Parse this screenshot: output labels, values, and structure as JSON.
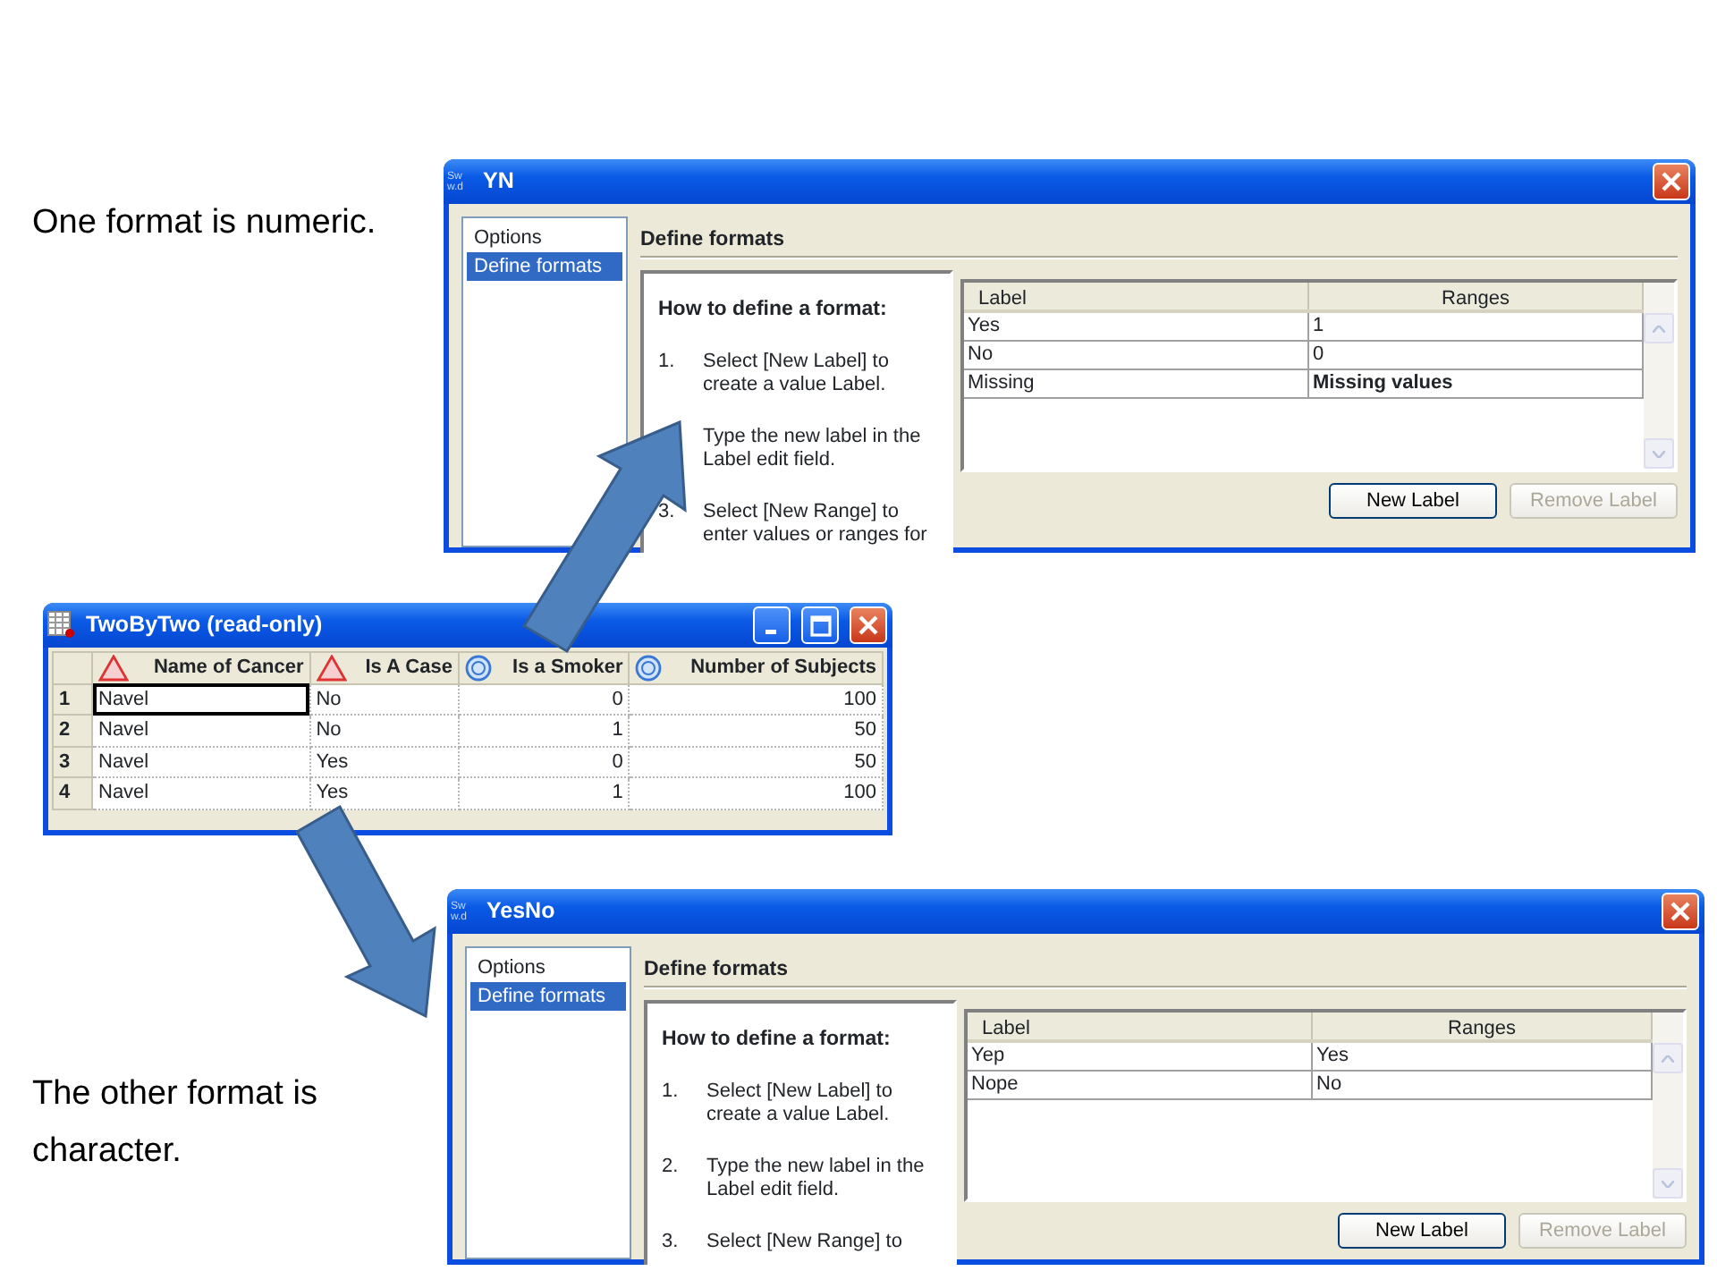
{
  "captions": [
    {
      "text": "One format is numeric."
    },
    {
      "text": "The other format is character."
    }
  ],
  "format_dialogs": [
    {
      "title": "YN",
      "app_icon": [
        "Sw",
        "w.d"
      ],
      "sidebar": {
        "items": [
          {
            "label": "Options",
            "selected": false
          },
          {
            "label": "Define formats",
            "selected": true
          }
        ]
      },
      "heading": "Define formats",
      "instructions": {
        "title": "How to define a format:",
        "steps": [
          {
            "number": "1.",
            "lines": [
              "Select [New Label] to",
              "create a value Label."
            ]
          },
          {
            "lines": [
              "Type the new label in the",
              "Label edit field."
            ]
          },
          {
            "number": "3.",
            "lines": [
              "Select [New Range] to",
              "enter values or ranges for"
            ]
          }
        ]
      },
      "grid": {
        "columns": [
          "Label",
          "Ranges"
        ],
        "rows": [
          {
            "label": "Yes",
            "ranges": "1",
            "bold": false
          },
          {
            "label": "No",
            "ranges": "0",
            "bold": false
          },
          {
            "label": "Missing",
            "ranges": "Missing values",
            "bold": true
          }
        ]
      },
      "buttons": [
        {
          "label": "New Label",
          "disabled": false
        },
        {
          "label": "Remove Label",
          "disabled": true
        }
      ]
    },
    {
      "title": "YesNo",
      "app_icon": [
        "Sw",
        "w.d"
      ],
      "sidebar": {
        "items": [
          {
            "label": "Options",
            "selected": false
          },
          {
            "label": "Define formats",
            "selected": true
          }
        ]
      },
      "heading": "Define formats",
      "instructions": {
        "title": "How to define a format:",
        "steps": [
          {
            "number": "1.",
            "lines": [
              "Select [New Label] to",
              "create a value Label."
            ]
          },
          {
            "number": "2.",
            "lines": [
              "Type the new label in the",
              "Label edit field."
            ]
          },
          {
            "number": "3.",
            "lines": [
              "Select [New Range] to"
            ]
          }
        ]
      },
      "grid": {
        "columns": [
          "Label",
          "Ranges"
        ],
        "rows": [
          {
            "label": "Yep",
            "ranges": "Yes",
            "bold": false
          },
          {
            "label": "Nope",
            "ranges": "No",
            "bold": false
          }
        ]
      },
      "buttons": [
        {
          "label": "New Label",
          "disabled": false
        },
        {
          "label": "Remove Label",
          "disabled": true
        }
      ]
    }
  ],
  "data_window": {
    "title": "TwoByTwo (read-only)",
    "columns": [
      {
        "name": "Name of Cancer",
        "kind": "character"
      },
      {
        "name": "Is A Case",
        "kind": "character"
      },
      {
        "name": "Is a Smoker",
        "kind": "numeric"
      },
      {
        "name": "Number of Subjects",
        "kind": "numeric"
      }
    ],
    "rows": [
      {
        "header": "1",
        "cells": [
          {
            "text": "Navel",
            "selected": true
          },
          {
            "text": "No",
            "selected": false
          },
          {
            "text": "0",
            "selected": false
          },
          {
            "text": "100",
            "selected": false
          }
        ]
      },
      {
        "header": "2",
        "cells": [
          {
            "text": "Navel",
            "selected": false
          },
          {
            "text": "No",
            "selected": false
          },
          {
            "text": "1",
            "selected": false
          },
          {
            "text": "50",
            "selected": false
          }
        ]
      },
      {
        "header": "3",
        "cells": [
          {
            "text": "Navel",
            "selected": false
          },
          {
            "text": "Yes",
            "selected": false
          },
          {
            "text": "0",
            "selected": false
          },
          {
            "text": "50",
            "selected": false
          }
        ]
      },
      {
        "header": "4",
        "cells": [
          {
            "text": "Navel",
            "selected": false
          },
          {
            "text": "Yes",
            "selected": false
          },
          {
            "text": "1",
            "selected": false
          },
          {
            "text": "100",
            "selected": false
          }
        ]
      }
    ]
  }
}
